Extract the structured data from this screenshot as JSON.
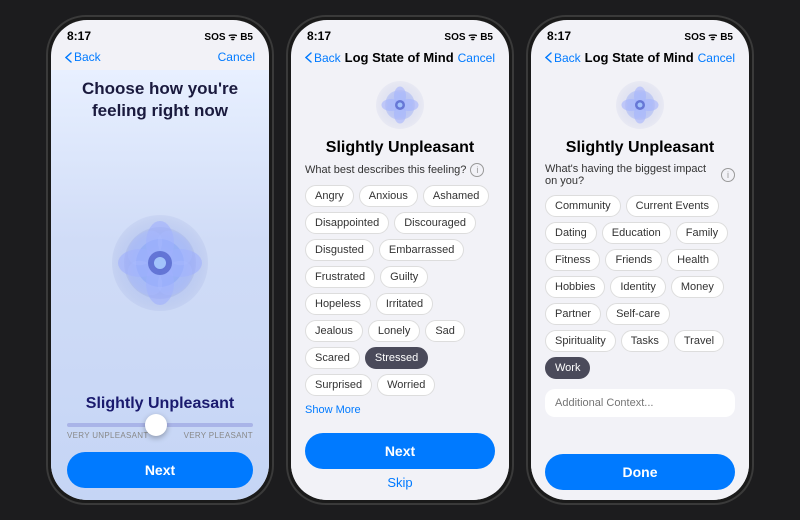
{
  "phones": [
    {
      "id": "phone1",
      "status": {
        "time": "8:17",
        "right": "SOS ᯤ B5"
      },
      "nav": {
        "back": "Back",
        "title": "",
        "cancel": "Cancel"
      },
      "prompt": "Choose how you're feeling right now",
      "mood": "Slightly Unpleasant",
      "slider": {
        "left_label": "VERY UNPLEASANT",
        "right_label": "VERY PLEASANT"
      },
      "next_button": "Next"
    },
    {
      "id": "phone2",
      "status": {
        "time": "8:17",
        "right": "SOS ᯤ B5"
      },
      "nav": {
        "back": "Back",
        "title": "Log State of Mind",
        "cancel": "Cancel"
      },
      "mood": "Slightly Unpleasant",
      "question": "What best describes this feeling?",
      "tags": [
        {
          "label": "Angry",
          "selected": false
        },
        {
          "label": "Anxious",
          "selected": false
        },
        {
          "label": "Ashamed",
          "selected": false
        },
        {
          "label": "Disappointed",
          "selected": false
        },
        {
          "label": "Discouraged",
          "selected": false
        },
        {
          "label": "Disgusted",
          "selected": false
        },
        {
          "label": "Embarrassed",
          "selected": false
        },
        {
          "label": "Frustrated",
          "selected": false
        },
        {
          "label": "Guilty",
          "selected": false
        },
        {
          "label": "Hopeless",
          "selected": false
        },
        {
          "label": "Irritated",
          "selected": false
        },
        {
          "label": "Jealous",
          "selected": false
        },
        {
          "label": "Lonely",
          "selected": false
        },
        {
          "label": "Sad",
          "selected": false
        },
        {
          "label": "Scared",
          "selected": false
        },
        {
          "label": "Stressed",
          "selected": true
        },
        {
          "label": "Surprised",
          "selected": false
        },
        {
          "label": "Worried",
          "selected": false
        }
      ],
      "show_more": "Show More",
      "next_button": "Next",
      "skip_button": "Skip"
    },
    {
      "id": "phone3",
      "status": {
        "time": "8:17",
        "right": "SOS ᯤ B5"
      },
      "nav": {
        "back": "Back",
        "title": "Log State of Mind",
        "cancel": "Cancel"
      },
      "mood": "Slightly Unpleasant",
      "question": "What's having the biggest impact on you?",
      "tags": [
        {
          "label": "Community",
          "selected": false
        },
        {
          "label": "Current Events",
          "selected": false
        },
        {
          "label": "Dating",
          "selected": false
        },
        {
          "label": "Education",
          "selected": false
        },
        {
          "label": "Family",
          "selected": false
        },
        {
          "label": "Fitness",
          "selected": false
        },
        {
          "label": "Friends",
          "selected": false
        },
        {
          "label": "Health",
          "selected": false
        },
        {
          "label": "Hobbies",
          "selected": false
        },
        {
          "label": "Identity",
          "selected": false
        },
        {
          "label": "Money",
          "selected": false
        },
        {
          "label": "Partner",
          "selected": false
        },
        {
          "label": "Self-care",
          "selected": false
        },
        {
          "label": "Spirituality",
          "selected": false
        },
        {
          "label": "Tasks",
          "selected": false
        },
        {
          "label": "Travel",
          "selected": false
        },
        {
          "label": "Work",
          "selected": true
        }
      ],
      "context_placeholder": "Additional Context...",
      "done_button": "Done"
    }
  ]
}
